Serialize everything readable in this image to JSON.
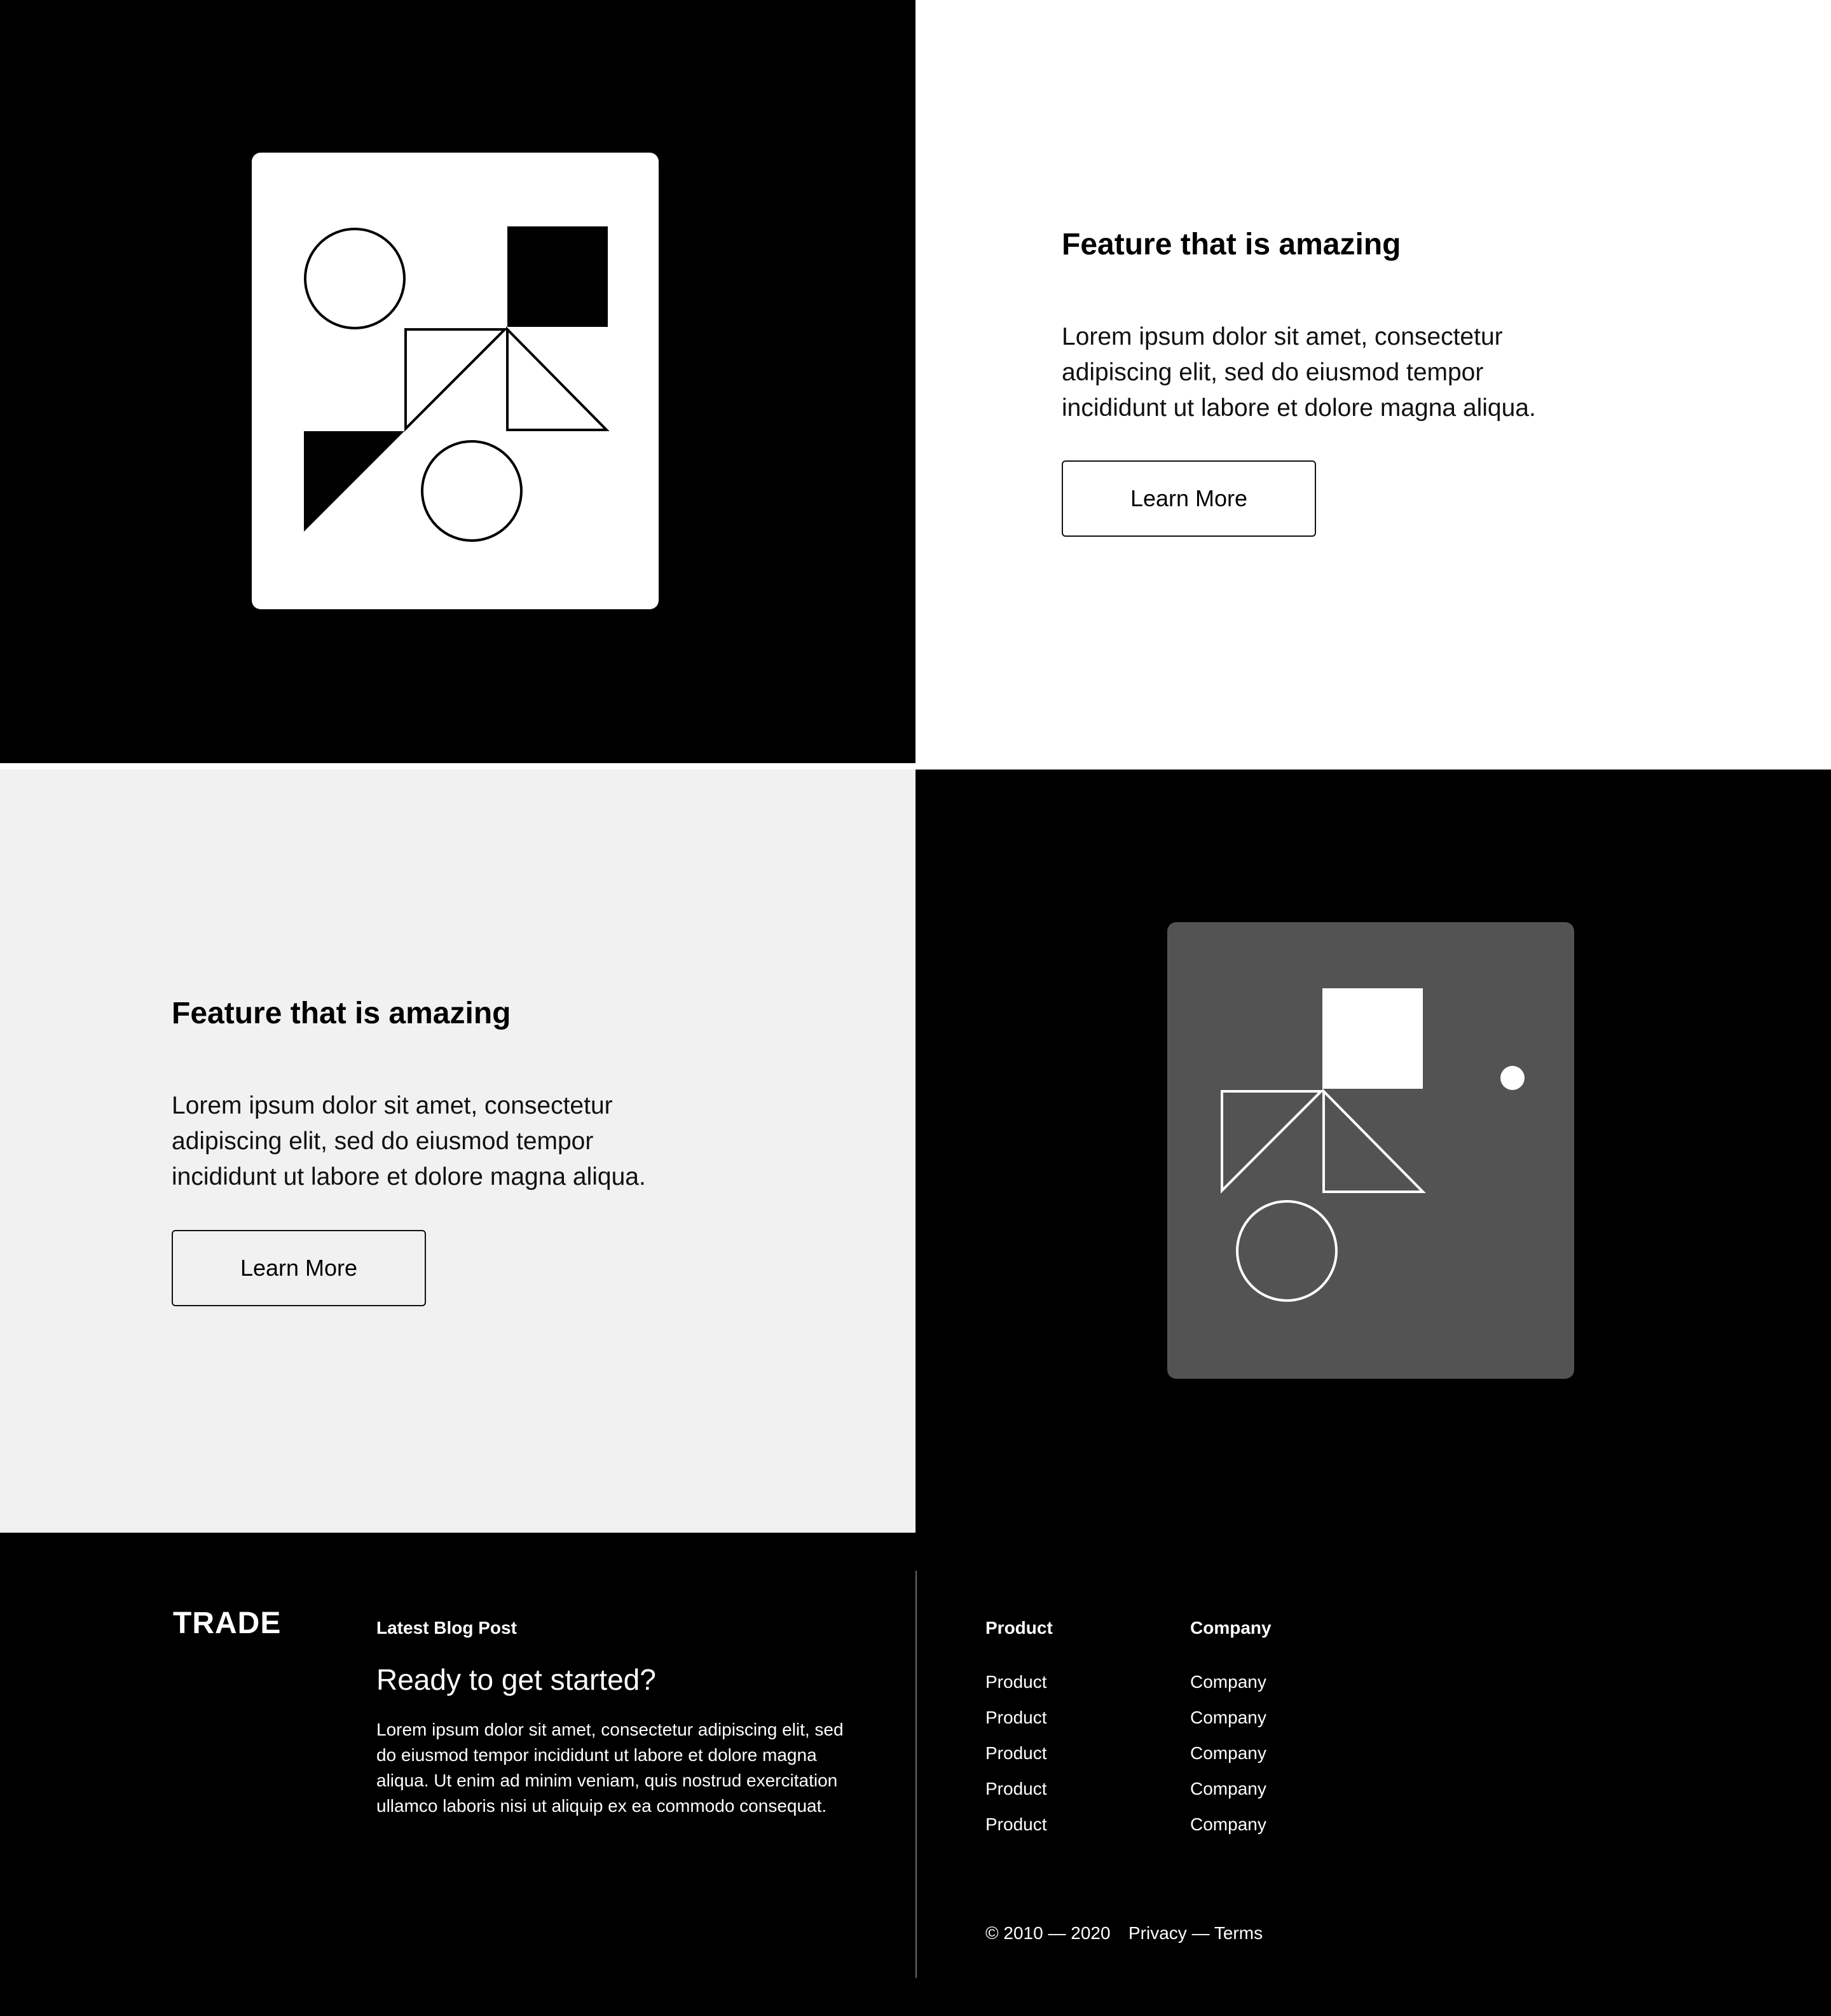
{
  "feature_1": {
    "title": "Feature that is amazing",
    "body": "Lorem ipsum dolor sit amet, consectetur adipiscing elit, sed do eiusmod tempor incididunt ut labore et dolore magna aliqua.",
    "button_label": "Learn More"
  },
  "feature_2": {
    "title": "Feature that is amazing",
    "body": "Lorem ipsum dolor sit amet, consectetur adipiscing elit, sed do eiusmod tempor incididunt ut labore et dolore magna aliqua.",
    "button_label": "Learn More"
  },
  "footer": {
    "logo": "TRADE",
    "blog": {
      "heading": "Latest Blog Post",
      "title": "Ready to get started?",
      "body": "Lorem ipsum dolor sit amet, consectetur adipiscing elit, sed do eiusmod tempor incididunt ut labore et dolore magna aliqua. Ut enim ad minim veniam, quis nostrud exercitation ullamco laboris nisi ut aliquip ex ea commodo consequat."
    },
    "product_column": {
      "heading": "Product",
      "links": [
        "Product",
        "Product",
        "Product",
        "Product",
        "Product"
      ]
    },
    "company_column": {
      "heading": "Company",
      "links": [
        "Company",
        "Company",
        "Company",
        "Company",
        "Company"
      ]
    },
    "copyright": "© 2010 — 2020",
    "legal_links": "Privacy — Terms"
  },
  "colors": {
    "black": "#000000",
    "white": "#ffffff",
    "light_gray": "#f1f1f1",
    "card_gray": "#535353"
  }
}
